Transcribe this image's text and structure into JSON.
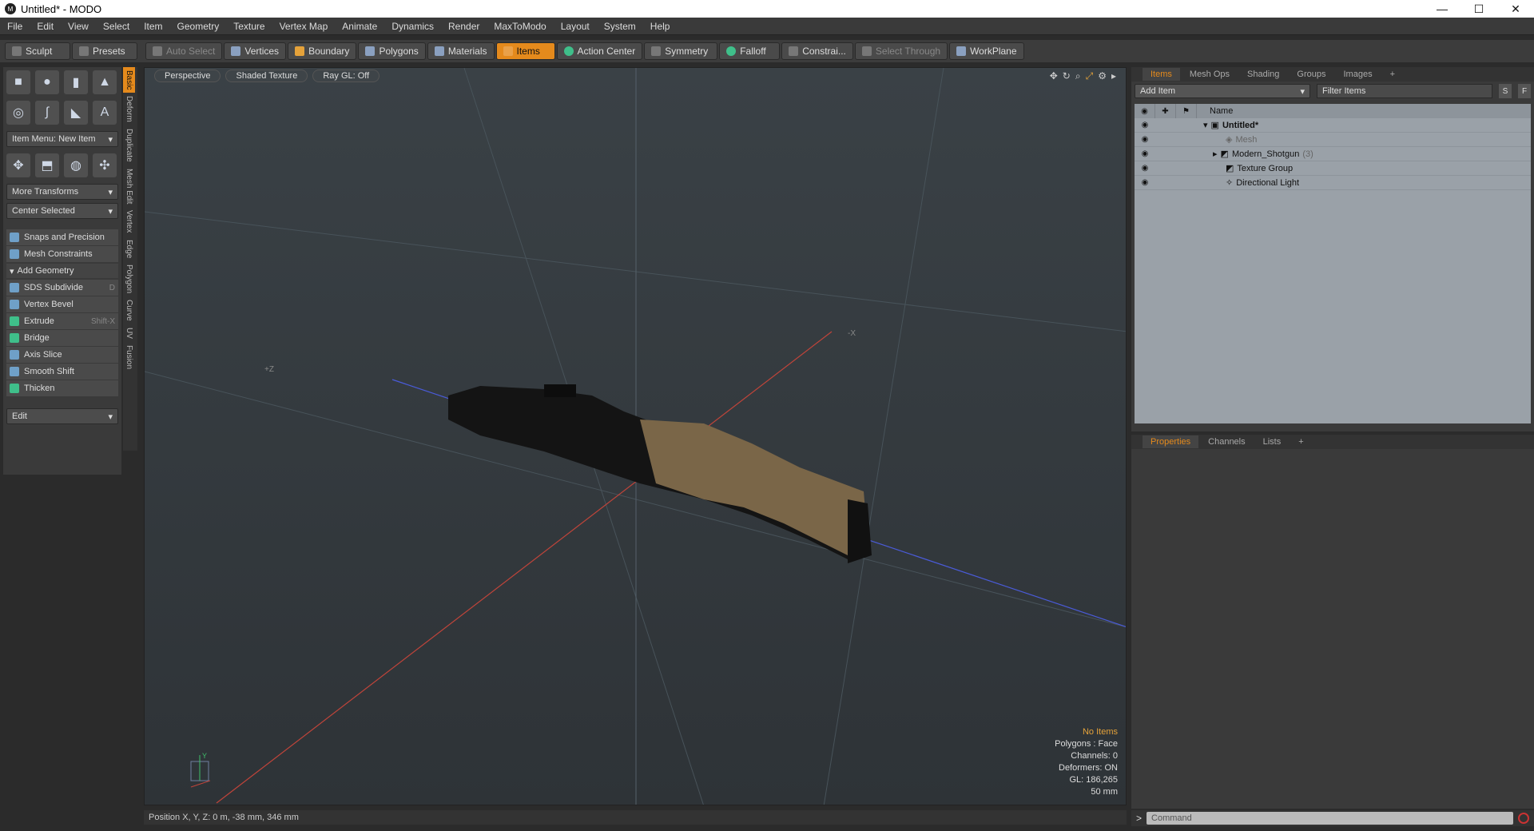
{
  "window": {
    "title": "Untitled* - MODO",
    "controls": [
      "—",
      "☐",
      "✕"
    ]
  },
  "menu": [
    "File",
    "Edit",
    "View",
    "Select",
    "Item",
    "Geometry",
    "Texture",
    "Vertex Map",
    "Animate",
    "Dynamics",
    "Render",
    "MaxToModo",
    "Layout",
    "System",
    "Help"
  ],
  "toolbar": {
    "sculpt": "Sculpt",
    "presets": "Presets",
    "auto_select": "Auto Select",
    "vertices": "Vertices",
    "boundary": "Boundary",
    "polygons": "Polygons",
    "materials": "Materials",
    "items": "Items",
    "action_center": "Action Center",
    "symmetry": "Symmetry",
    "falloff": "Falloff",
    "constraint": "Constrai...",
    "select_through": "Select Through",
    "workplane": "WorkPlane"
  },
  "left": {
    "item_menu": "Item Menu: New Item",
    "more_transforms": "More Transforms",
    "center_selected": "Center Selected",
    "snaps": "Snaps and Precision",
    "mesh_constraints": "Mesh Constraints",
    "add_geometry": "Add Geometry",
    "tools": [
      {
        "label": "SDS Subdivide",
        "shortcut": "D"
      },
      {
        "label": "Vertex Bevel",
        "shortcut": ""
      },
      {
        "label": "Extrude",
        "shortcut": "Shift-X"
      },
      {
        "label": "Bridge",
        "shortcut": ""
      },
      {
        "label": "Axis Slice",
        "shortcut": ""
      },
      {
        "label": "Smooth Shift",
        "shortcut": ""
      },
      {
        "label": "Thicken",
        "shortcut": ""
      }
    ],
    "edit": "Edit",
    "vtabs": [
      "Basic",
      "Deform",
      "Duplicate",
      "Mesh Edit",
      "Vertex",
      "Edge",
      "Polygon",
      "Curve",
      "UV",
      "Fusion"
    ]
  },
  "viewport": {
    "view": "Perspective",
    "shading": "Shaded Texture",
    "raygl": "Ray GL: Off",
    "stats": {
      "items": "No Items",
      "polygons": "Polygons : Face",
      "channels": "Channels: 0",
      "deformers": "Deformers: ON",
      "gl": "GL: 186,265",
      "unit": "50 mm"
    },
    "axis_z": "+Z",
    "axis_x": "-X",
    "axis_y": "Y"
  },
  "status": {
    "position": "Position X, Y, Z:   0 m, -38 mm, 346 mm"
  },
  "items_panel": {
    "tabs": [
      "Items",
      "Mesh Ops",
      "Shading",
      "Groups",
      "Images",
      "+"
    ],
    "add_item": "Add Item",
    "filter": "Filter Items",
    "s": "S",
    "f": "F",
    "name_col": "Name",
    "rows": [
      {
        "label": "Untitled*",
        "extra": ""
      },
      {
        "label": "Mesh",
        "extra": ""
      },
      {
        "label": "Modern_Shotgun",
        "extra": "(3)"
      },
      {
        "label": "Texture Group",
        "extra": ""
      },
      {
        "label": "Directional Light",
        "extra": ""
      }
    ]
  },
  "props_panel": {
    "tabs": [
      "Properties",
      "Channels",
      "Lists",
      "+"
    ]
  },
  "command": {
    "placeholder": "Command",
    "prompt": ">"
  },
  "colors": {
    "accent": "#e58a1c",
    "viewport": "#30363a",
    "tree": "#9aa1a8"
  }
}
